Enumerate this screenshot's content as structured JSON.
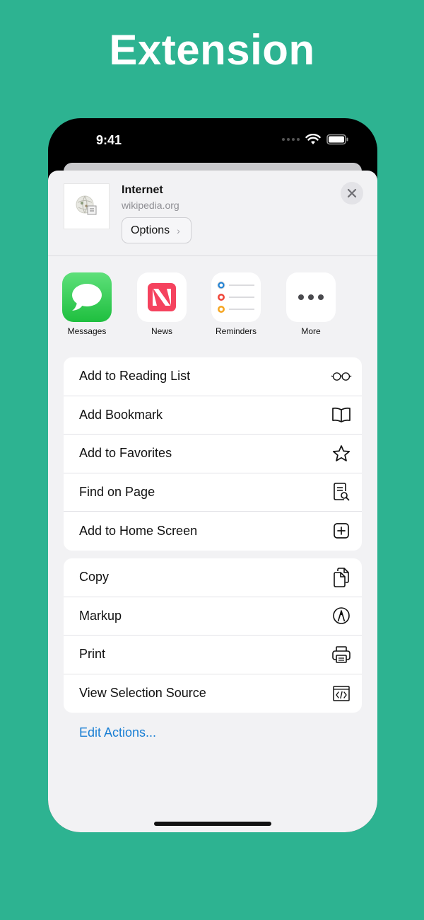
{
  "hero": {
    "title": "Extension"
  },
  "status_bar": {
    "time": "9:41"
  },
  "share_sheet": {
    "site_title": "Internet",
    "site_url": "wikipedia.org",
    "options_label": "Options",
    "apps": [
      {
        "label": "Messages",
        "icon": "messages-icon",
        "color": "#29c74a"
      },
      {
        "label": "News",
        "icon": "news-icon",
        "color": "#f5425e"
      },
      {
        "label": "Reminders",
        "icon": "reminders-icon",
        "color": "#1a7fd4"
      },
      {
        "label": "More",
        "icon": "more-icon",
        "color": "#4a4a4e"
      }
    ],
    "actions_group_1": [
      {
        "label": "Add to Reading List",
        "icon": "glasses-icon"
      },
      {
        "label": "Add Bookmark",
        "icon": "book-icon"
      },
      {
        "label": "Add to Favorites",
        "icon": "star-icon"
      },
      {
        "label": "Find on Page",
        "icon": "find-document-icon"
      },
      {
        "label": "Add to Home Screen",
        "icon": "plus-square-icon"
      }
    ],
    "actions_group_2": [
      {
        "label": "Copy",
        "icon": "copy-icon"
      },
      {
        "label": "Markup",
        "icon": "markup-icon"
      },
      {
        "label": "Print",
        "icon": "printer-icon"
      },
      {
        "label": "View Selection Source",
        "icon": "code-source-icon"
      }
    ],
    "edit_actions_label": "Edit Actions..."
  },
  "colors": {
    "background": "#2db391",
    "link": "#1a7fd4"
  }
}
